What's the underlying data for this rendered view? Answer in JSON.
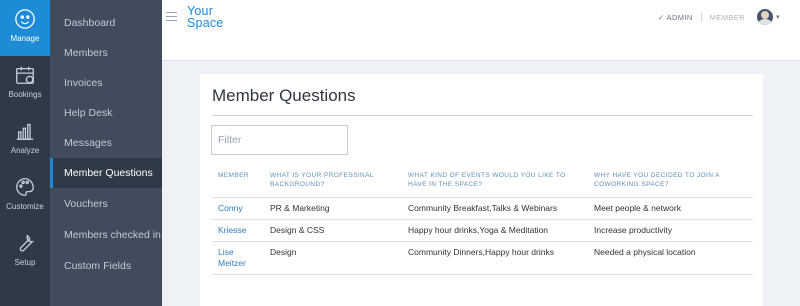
{
  "rail": [
    {
      "label": "Manage",
      "icon": "manage-icon",
      "active": true
    },
    {
      "label": "Bookings",
      "icon": "calendar-icon"
    },
    {
      "label": "Analyze",
      "icon": "bar-chart-icon"
    },
    {
      "label": "Customize",
      "icon": "palette-icon"
    },
    {
      "label": "Setup",
      "icon": "wrench-icon"
    }
  ],
  "sidebar": [
    {
      "label": "Dashboard"
    },
    {
      "label": "Members"
    },
    {
      "label": "Invoices"
    },
    {
      "label": "Help Desk"
    },
    {
      "label": "Messages"
    },
    {
      "label": "Member Questions",
      "active": true
    },
    {
      "label": "Vouchers"
    },
    {
      "label": "Members checked in"
    },
    {
      "label": "Custom Fields"
    }
  ],
  "header": {
    "logo_line1": "Your",
    "logo_line2": "Space",
    "role_admin_check": "✓",
    "role_admin": "ADMIN",
    "role_member": "MEMBER",
    "caret": "▾"
  },
  "page": {
    "title": "Member Questions",
    "filter_placeholder": "Filter"
  },
  "table": {
    "columns": [
      "MEMBER",
      "WHAT IS YOUR PROFESSINAL BACKGROUND?",
      "WHAT KIND OF EVENTS WOULD YOU LIKE TO HAVE IN THE SPACE?",
      "WHY HAVE YOU DECIDED TO JOIN A COWORKING SPACE?"
    ],
    "rows": [
      [
        "Conny",
        "PR & Marketing",
        "Community Breakfast,Talks & Webinars",
        "Meet people & network"
      ],
      [
        "Kriesse",
        "Design & CSS",
        "Happy hour drinks,Yoga & Meditation",
        "Increase productivity"
      ],
      [
        "Lise Meitzer",
        "Design",
        "Community Dinners,Happy hour drinks",
        "Needed a physical location"
      ]
    ]
  },
  "colors": {
    "accent": "#1e8bd6",
    "rail_bg": "#2f3a49",
    "sidebar_bg": "#404b5c",
    "link": "#2f7fc1"
  }
}
